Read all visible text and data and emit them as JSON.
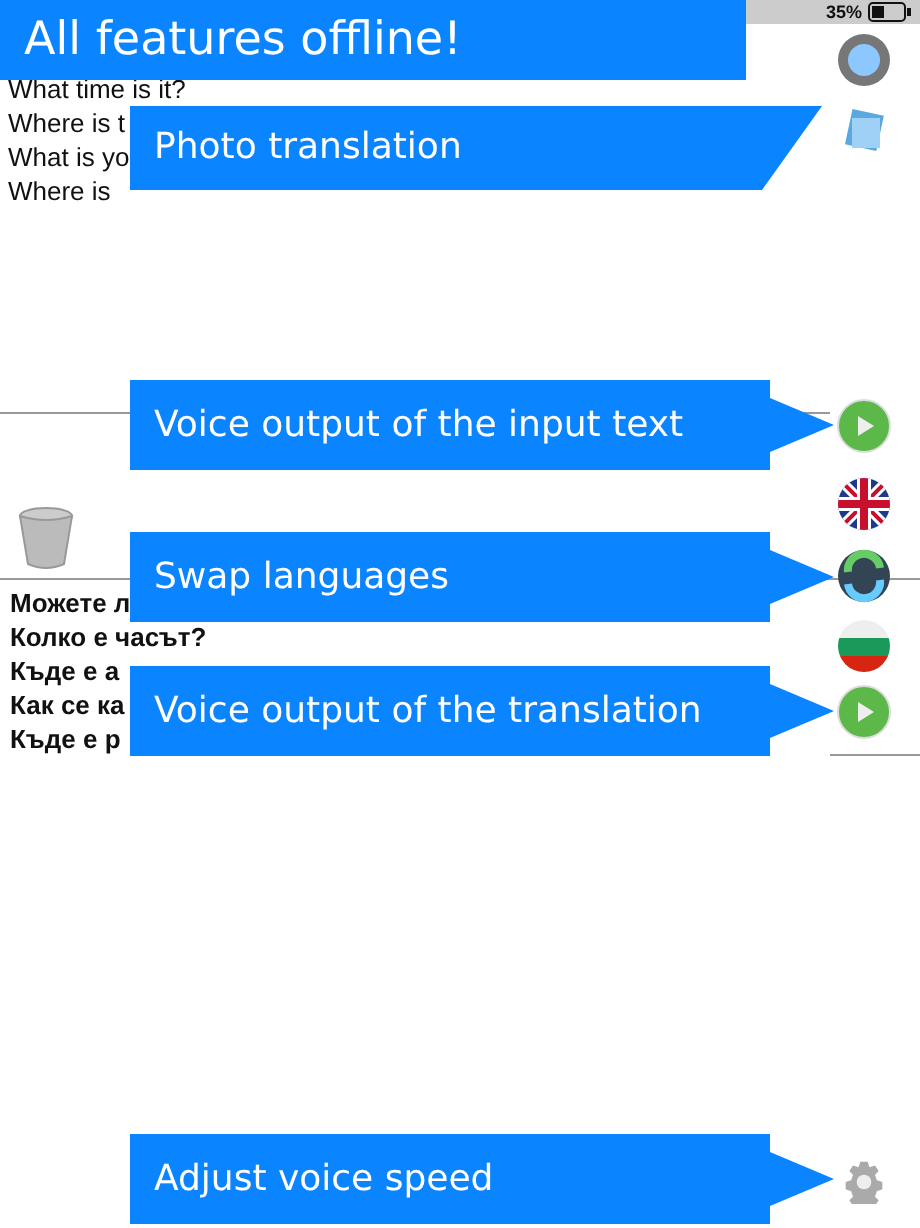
{
  "status_bar": {
    "battery": "35%"
  },
  "input_lines": [
    "What time is it?",
    "Where is t",
    "What is yo",
    "Where is"
  ],
  "translation_lines": [
    "Можете л",
    "Колко е часът?",
    "Къде е а",
    "Как се ка",
    "Къде е р"
  ],
  "headline": "All features offline!",
  "callouts": [
    {
      "text": "Photo translation",
      "kind": "slant"
    },
    {
      "text": "Voice output of the input text",
      "kind": "arrow"
    },
    {
      "text": "Swap languages",
      "kind": "arrow"
    },
    {
      "text": "Voice output of the translation",
      "kind": "arrow"
    },
    {
      "text": "Adjust voice speed",
      "kind": "arrow"
    }
  ]
}
